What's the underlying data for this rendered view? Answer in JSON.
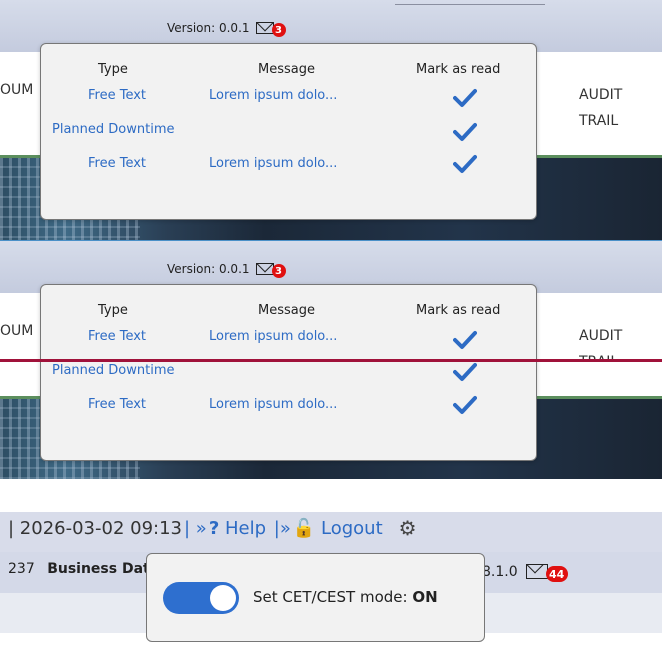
{
  "version_label": "Version: 0.0.1",
  "notifications": {
    "badge_count": "3",
    "columns": {
      "type": "Type",
      "message": "Message",
      "mark_read": "Mark as read"
    },
    "rows": [
      {
        "type": "Free Text",
        "message": "Lorem ipsum dolo..."
      },
      {
        "type": "Planned Downtime",
        "message": ""
      },
      {
        "type": "Free Text",
        "message": "Lorem ipsum dolo..."
      }
    ]
  },
  "nav": {
    "left_partial": "OUM",
    "audit_line1": "AUDIT",
    "audit_line2": "TRAIL"
  },
  "header": {
    "datetime": "| 2026-03-02 09:13",
    "help_label": "Help",
    "logout_label": "Logout",
    "info_partial": "237",
    "business_date_label": "Business Dat",
    "version_partial": "8.1.0",
    "badge_count": "44"
  },
  "cet_toggle": {
    "label": "Set CET/CEST mode:",
    "state": "ON",
    "enabled": true
  },
  "colors": {
    "link": "#2d6bc4",
    "badge": "#e01010",
    "toggle_on": "#2e6fcf",
    "divider_red": "#a0123a"
  }
}
